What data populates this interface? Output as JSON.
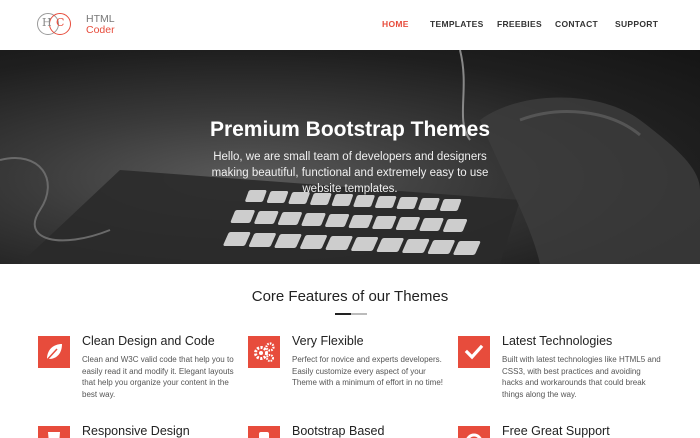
{
  "logo": {
    "letter_h": "H",
    "letter_c": "C",
    "line1": "HTML",
    "line2": "Coder"
  },
  "nav": {
    "items": [
      "HOME",
      "TEMPLATES",
      "FREEBIES",
      "CONTACT",
      "SUPPORT"
    ],
    "active": "HOME"
  },
  "hero": {
    "title": "Premium Bootstrap Themes",
    "subtitle": "Hello, we are small team of developers and designers making beautiful, functional and extremely easy to use website templates."
  },
  "features_section": {
    "title": "Core Features of our Themes",
    "items": [
      {
        "icon": "leaf-icon",
        "title": "Clean Design and Code",
        "text": "Clean and W3C valid code that help you to easily read it and modify it. Elegant layouts that help you organize your content in the best way."
      },
      {
        "icon": "gears-icon",
        "title": "Very Flexible",
        "text": "Perfect for novice and experts developers. Easily customize every aspect of your Theme with a minimum of effort in no time!"
      },
      {
        "icon": "check-icon",
        "title": "Latest Technologies",
        "text": "Built with latest technologies like HTML5 and CSS3, with best practices and avoiding hacks and workarounds that could break things along the way."
      },
      {
        "icon": "html5-icon",
        "title": "Responsive Design",
        "text": ""
      },
      {
        "icon": "bootstrap-icon",
        "title": "Bootstrap Based",
        "text": ""
      },
      {
        "icon": "lifebuoy-icon",
        "title": "Free Great Support",
        "text": ""
      }
    ]
  },
  "colors": {
    "accent": "#e74c3c",
    "text": "#333333",
    "hero_bg": "#1f1f1f"
  }
}
